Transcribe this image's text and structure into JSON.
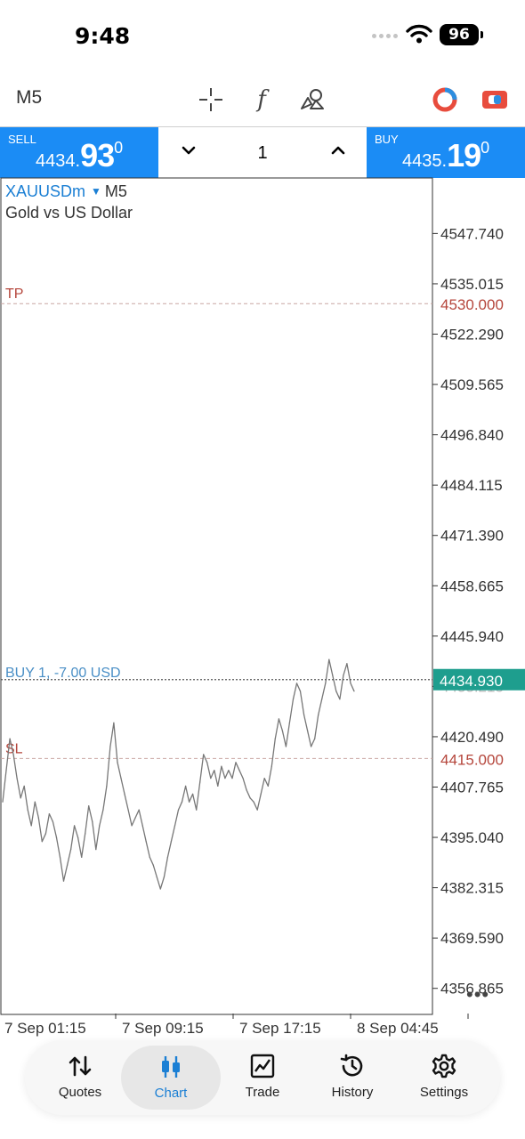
{
  "status_bar": {
    "time": "9:48",
    "battery": "96"
  },
  "toolbar": {
    "timeframe": "M5",
    "function_glyph": "f",
    "icons": [
      "crosshair-icon",
      "indicators-icon",
      "objects-icon",
      "trade-toggle-icon",
      "account-icon"
    ]
  },
  "trade_panel": {
    "sell": {
      "label": "SELL",
      "price_small": "4434.",
      "price_big": "93",
      "price_sup": "0"
    },
    "lot": "1",
    "buy": {
      "label": "BUY",
      "price_small": "4435.",
      "price_big": "19",
      "price_sup": "0"
    }
  },
  "chart": {
    "symbol": "XAUUSDm",
    "timeframe": "M5",
    "description": "Gold vs US Dollar",
    "tp_label": "TP",
    "sl_label": "SL",
    "position_label": "BUY 1, -7.00 USD",
    "tp_price": "4530.000",
    "sl_price": "4415.000",
    "current_price": "4434.930",
    "hidden_tick": "4433.215",
    "more": "•••"
  },
  "chart_data": {
    "type": "line",
    "title": "XAUUSDm M5",
    "y_ticks": [
      "4547.740",
      "4535.015",
      "4522.290",
      "4509.565",
      "4496.840",
      "4484.115",
      "4471.390",
      "4458.665",
      "4445.940",
      "4433.215",
      "4420.490",
      "4407.765",
      "4395.040",
      "4382.315",
      "4369.590",
      "4356.865"
    ],
    "ylim": [
      4350.5,
      4562
    ],
    "x_ticks": [
      "7 Sep 01:15",
      "7 Sep 09:15",
      "7 Sep 17:15",
      "8 Sep 04:45"
    ],
    "series": [
      {
        "values": [
          4404,
          4412,
          4420,
          4416,
          4410,
          4405,
          4408,
          4402,
          4398,
          4404,
          4400,
          4394,
          4396,
          4401,
          4399,
          4395,
          4390,
          4384,
          4388,
          4392,
          4398,
          4395,
          4390,
          4396,
          4403,
          4399,
          4392,
          4398,
          4402,
          4408,
          4418,
          4424,
          4414,
          4410,
          4406,
          4402,
          4398,
          4400,
          4402,
          4398,
          4394,
          4390,
          4388,
          4385,
          4382,
          4385,
          4390,
          4394,
          4398,
          4402,
          4404,
          4408,
          4404,
          4406,
          4402,
          4409,
          4416,
          4414,
          4410,
          4412,
          4408,
          4413,
          4410,
          4412,
          4410,
          4414,
          4412,
          4410,
          4407,
          4405,
          4404,
          4402,
          4406,
          4410,
          4408,
          4413,
          4420,
          4425,
          4422,
          4418,
          4424,
          4430,
          4434,
          4432,
          4426,
          4422,
          4418,
          4420,
          4426,
          4430,
          4434,
          4440,
          4436,
          4432,
          4430,
          4436,
          4439,
          4434,
          4432
        ]
      },
      {
        "values": [
          4434.93,
          4434.93
        ]
      }
    ],
    "levels": {
      "tp": 4530.0,
      "sl": 4415.0,
      "buy_entry": 4434.93
    }
  },
  "nav": {
    "items": [
      {
        "label": "Quotes",
        "icon": "quotes-icon"
      },
      {
        "label": "Chart",
        "icon": "chart-candles-icon"
      },
      {
        "label": "Trade",
        "icon": "trade-line-icon"
      },
      {
        "label": "History",
        "icon": "history-icon"
      },
      {
        "label": "Settings",
        "icon": "gear-icon"
      }
    ]
  },
  "colors": {
    "accent": "#1b8cf5",
    "link": "#1b7fd4",
    "level_red": "#b5463c",
    "bid_line": "#1e9e8e"
  }
}
